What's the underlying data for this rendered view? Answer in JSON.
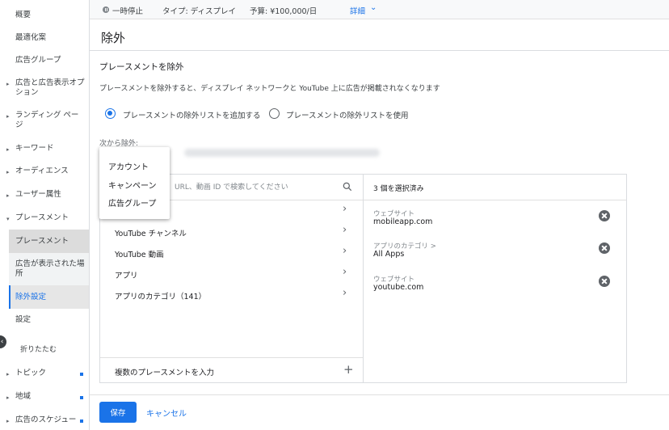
{
  "sidebar": {
    "items": {
      "overview": "概要",
      "recommendations": "最適化案",
      "ad_groups": "広告グループ",
      "ads_extensions": "広告と広告表示オプション",
      "landing_pages": "ランディング ページ",
      "keywords": "キーワード",
      "audiences": "オーディエンス",
      "demographics": "ユーザー属性",
      "placements": "プレースメント",
      "sub_placements": "プレースメント",
      "where_ads_showed": "広告が表示された場所",
      "exclusions": "除外設定",
      "settings": "設定",
      "collapse": "折りたたむ",
      "topics": "トピック",
      "locations": "地域",
      "ad_schedule": "広告のスケジュー"
    }
  },
  "topbar": {
    "status": "一時停止",
    "type": "タイプ: ディスプレイ",
    "budget": "予算: ¥100,000/日",
    "details": "詳細"
  },
  "page": {
    "title": "除外"
  },
  "main": {
    "section_title": "プレースメントを除外",
    "description": "プレースメントを除外すると、ディスプレイ ネットワークと YouTube 上に広告が掲載されなくなります",
    "radio_add": "プレースメントの除外リストを追加する",
    "radio_use": "プレースメントの除外リストを使用",
    "exclude_from_label": "次から除外:",
    "search_placeholder": "URL、動画 ID で検索してください",
    "categories": [
      "YouTube チャンネル",
      "YouTube 動画",
      "アプリ",
      "アプリのカテゴリ（141）"
    ],
    "bulk_entry": "複数のプレースメントを入力",
    "selected_count": "3 個を選択済み",
    "selected": [
      {
        "type": "ウェブサイト",
        "value": "mobileapp.com"
      },
      {
        "type": "アプリのカテゴリ >",
        "value": "All Apps"
      },
      {
        "type": "ウェブサイト",
        "value": "youtube.com"
      }
    ]
  },
  "dropdown": {
    "options": [
      "アカウント",
      "キャンペーン",
      "広告グループ"
    ]
  },
  "footer": {
    "save": "保存",
    "cancel": "キャンセル"
  },
  "colors": {
    "accent": "#1a73e8",
    "text": "#202124",
    "muted": "#80868b"
  }
}
